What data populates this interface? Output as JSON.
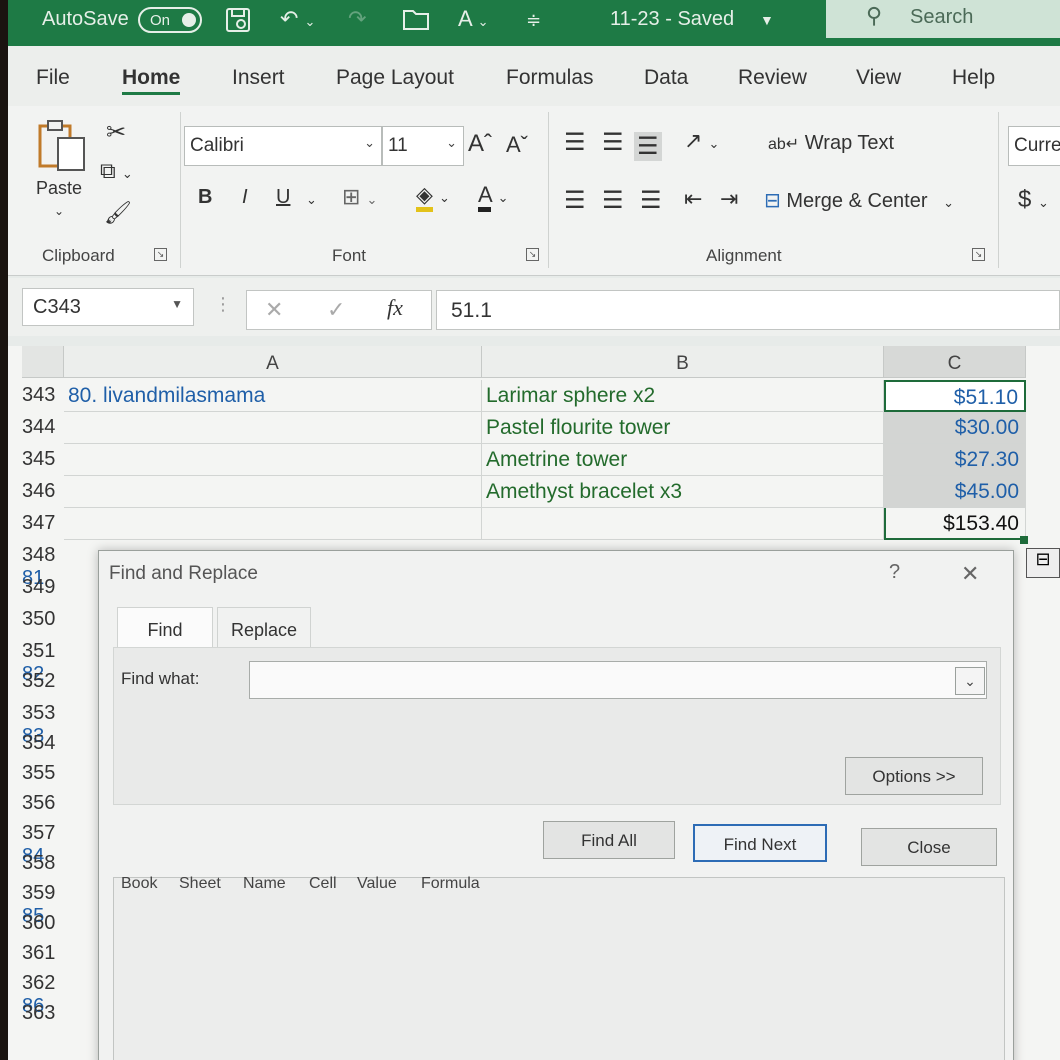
{
  "titlebar": {
    "autosave_label": "AutoSave",
    "autosave_state": "On",
    "title": "11-23  -  Saved",
    "search_placeholder": "Search"
  },
  "menu": [
    "File",
    "Home",
    "Insert",
    "Page Layout",
    "Formulas",
    "Data",
    "Review",
    "View",
    "Help"
  ],
  "ribbon": {
    "clipboard": {
      "paste": "Paste",
      "label": "Clipboard"
    },
    "font": {
      "name": "Calibri",
      "size": "11",
      "label": "Font",
      "bold": "B",
      "italic": "I",
      "underline": "U"
    },
    "alignment": {
      "wrap_text": "Wrap Text",
      "merge_center": "Merge & Center",
      "label": "Alignment"
    },
    "number": {
      "format": "Curre",
      "currency_symbol": "$"
    }
  },
  "formula_bar": {
    "name_box": "C343",
    "fx": "fx",
    "value": "51.1"
  },
  "sheet": {
    "columns": [
      "A",
      "B",
      "C"
    ],
    "rows": [
      {
        "num": "343",
        "a": "80. livandmilasmama",
        "b": "Larimar sphere x2",
        "c": "$51.10"
      },
      {
        "num": "344",
        "a": "",
        "b": "Pastel flourite tower",
        "c": "$30.00"
      },
      {
        "num": "345",
        "a": "",
        "b": "Ametrine tower",
        "c": "$27.30"
      },
      {
        "num": "346",
        "a": "",
        "b": "Amethyst bracelet x3",
        "c": "$45.00"
      },
      {
        "num": "347",
        "a": "",
        "b": "",
        "c": "$153.40"
      }
    ],
    "lower_rows": [
      {
        "num": "348",
        "a": "81"
      },
      {
        "num": "349",
        "a": ""
      },
      {
        "num": "350",
        "a": ""
      },
      {
        "num": "351",
        "a": "82"
      },
      {
        "num": "352",
        "a": ""
      },
      {
        "num": "353",
        "a": "83"
      },
      {
        "num": "354",
        "a": ""
      },
      {
        "num": "355",
        "a": ""
      },
      {
        "num": "356",
        "a": ""
      },
      {
        "num": "357",
        "a": "84"
      },
      {
        "num": "358",
        "a": ""
      },
      {
        "num": "359",
        "a": "85"
      },
      {
        "num": "360",
        "a": ""
      },
      {
        "num": "361",
        "a": ""
      },
      {
        "num": "362",
        "a": "86"
      },
      {
        "num": "363",
        "a": ""
      }
    ]
  },
  "dialog": {
    "title": "Find and Replace",
    "help": "?",
    "close_x": "✕",
    "tabs": [
      "Find",
      "Replace"
    ],
    "find_what_label": "Find what:",
    "find_value": "",
    "options_button": "Options >>",
    "find_all": "Find All",
    "find_next": "Find Next",
    "close": "Close",
    "result_columns": [
      "Book",
      "Sheet",
      "Name",
      "Cell",
      "Value",
      "Formula"
    ]
  }
}
